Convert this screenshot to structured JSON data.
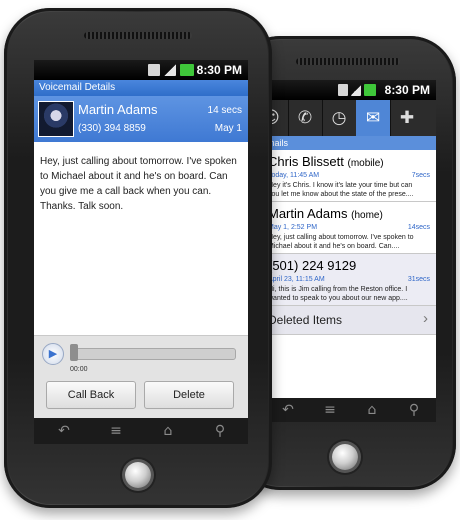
{
  "colors": {
    "accent": "#3f79d3",
    "link_blue": "#2f66c8",
    "status_bg": "#000000"
  },
  "status_bar": {
    "time": "8:30 PM",
    "icons": [
      "3g-icon",
      "signal-icon",
      "battery-icon"
    ]
  },
  "detail_phone": {
    "title": "Voicemail Details",
    "contact": {
      "name": "Martin Adams",
      "number": "(330) 394 8859",
      "duration": "14 secs",
      "date": "May 1"
    },
    "transcript": "Hey, just calling about tomorrow. I've spoken to Michael about it and he's on board. Can you give me a call back when you can. Thanks. Talk soon.",
    "player": {
      "elapsed": "00:00",
      "progress": 0
    },
    "buttons": {
      "call_back": "Call Back",
      "delete": "Delete"
    },
    "softkeys": [
      "back-icon",
      "menu-icon",
      "home-icon",
      "search-icon"
    ]
  },
  "list_phone": {
    "tabs": [
      "contacts-icon",
      "phone-icon",
      "clock-icon",
      "mail-icon",
      "dialpad-icon"
    ],
    "subheader": "mails",
    "voicemails": [
      {
        "name": "Chris Blissett",
        "tag": "(mobile)",
        "date": "Today, 11:45 AM",
        "duration": "7secs",
        "snippet": "Hey it's Chris. I know it's late your time but can you let me know about the state of the prese...."
      },
      {
        "name": "Martin Adams",
        "tag": "(home)",
        "date": "May 1, 2:52 PM",
        "duration": "14secs",
        "snippet": "Hey, just calling about tomorrow. I've spoken to Michael about it and he's on board. Can...."
      },
      {
        "name": "(501) 224 9129",
        "tag": "",
        "date": "April 23, 11:15 AM",
        "duration": "31secs",
        "snippet": "Hi, this is Jim calling from the Reston office. I wanted to speak to you about our new app...."
      }
    ],
    "deleted_items": "Deleted Items",
    "chevron": "›",
    "softkeys": [
      "back-icon",
      "menu-icon",
      "home-icon",
      "search-icon"
    ]
  }
}
